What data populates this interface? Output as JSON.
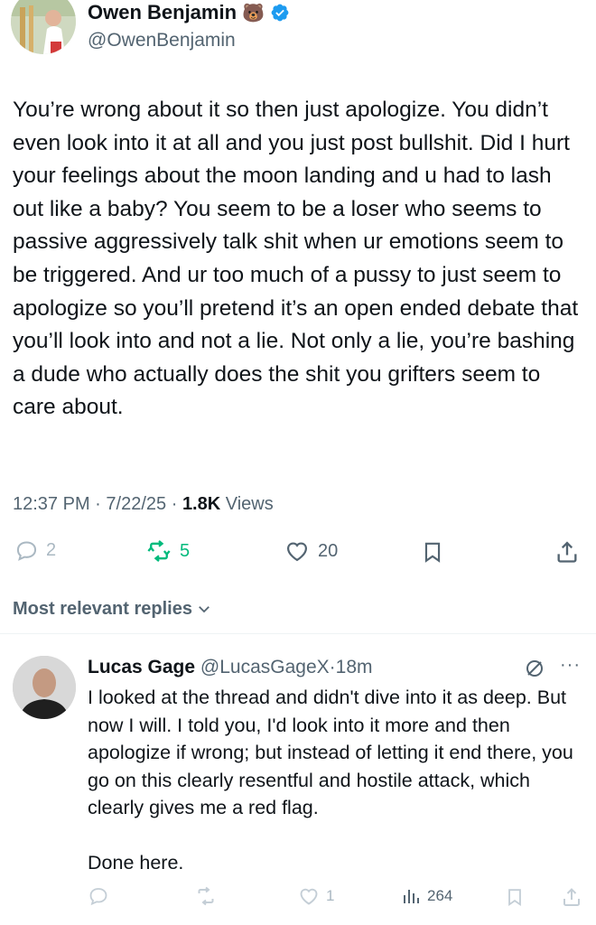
{
  "tweet": {
    "author_name": "Owen Benjamin",
    "author_emoji": "🐻",
    "author_handle": "@OwenBenjamin",
    "text": "You’re wrong about it so then just apologize. You didn’t even look into it at all and you just post bullshit. Did I hurt your feelings about the moon landing and u had to lash out like a baby? You seem to be a loser who seems to passive aggressively talk shit when ur emotions seem to be triggered. And ur too much of a pussy to just seem to apologize so you’ll pretend it’s an open ended debate that you’ll look into and not a lie. Not only a lie, you’re bashing a dude who actually does the shit you grifters seem to care about.",
    "time": "12:37 PM",
    "date": "7/22/25",
    "sep": "·",
    "views_count": "1.8K",
    "views_label": "Views",
    "replies": "2",
    "reposts": "5",
    "likes": "20"
  },
  "sort_label": "Most relevant replies",
  "reply": {
    "name": "Lucas Gage",
    "handle": "@LucasGageX",
    "sep": "·",
    "age": "18m",
    "text": "I looked at the thread and didn't dive into it as deep. But now I will. I told you, I'd look into it more and then apologize if wrong; but instead of letting it end there, you go on this clearly resentful and hostile attack, which clearly gives me a red flag.\n\nDone here.",
    "likes": "1",
    "views": "264"
  },
  "colors": {
    "text": "#0f1419",
    "muted": "#536471",
    "accent": "#1d9bf0",
    "repost": "#00ba7c"
  },
  "icons": [
    "verified-badge-icon",
    "reply-icon",
    "repost-icon",
    "like-icon",
    "bookmark-icon",
    "share-icon",
    "chevron-down-icon",
    "grok-icon",
    "more-icon",
    "views-icon"
  ]
}
